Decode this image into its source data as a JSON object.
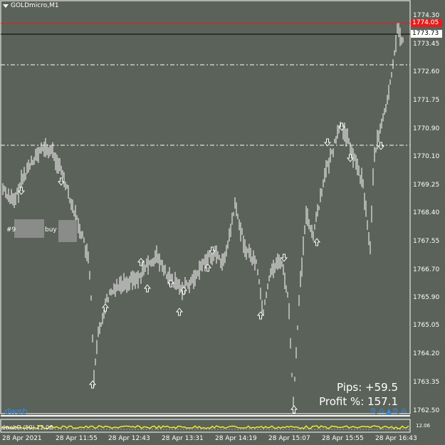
{
  "window": {
    "title": "GOLDmicro,M1"
  },
  "price_axis": {
    "labels": [
      "1774.30",
      "1773.45",
      "1772.60",
      "1771.75",
      "1770.90",
      "1770.10",
      "1769.25",
      "1768.40",
      "1767.55",
      "1766.70",
      "1765.90",
      "1765.05",
      "1764.20",
      "1763.35",
      "1762.50"
    ],
    "tags": [
      {
        "value": "1774.05",
        "bg": "#e81c1c",
        "fg": "#ffffff"
      },
      {
        "value": "1773.73",
        "bg": "#ffffff",
        "fg": "#000000"
      }
    ]
  },
  "time_axis": {
    "labels": [
      "28 Apr 2021",
      "28 Apr 11:55",
      "28 Apr 12:43",
      "28 Apr 13:31",
      "28 Apr 14:19",
      "28 Apr 15:07",
      "28 Apr 15:55",
      "28 Apr 16:43"
    ]
  },
  "order_box": {
    "left_label": "#9",
    "right_label": "buy"
  },
  "stats": {
    "pips": "Pips: +59.5",
    "profit": "Profit %: 157.1"
  },
  "brand": {
    "name": "dweb",
    "color": "#3a8be0",
    "icons": "♏♎▲♏♎"
  },
  "indicator": {
    "title": "dwebD (50) 12.06",
    "value": "12.06",
    "color": "#f2ea2a"
  },
  "colors": {
    "background": "#5b6259",
    "candle": "#ffffff",
    "ask_line": "#e81c1c",
    "bid_line": "#000000",
    "level_line": "#ffffff"
  }
}
